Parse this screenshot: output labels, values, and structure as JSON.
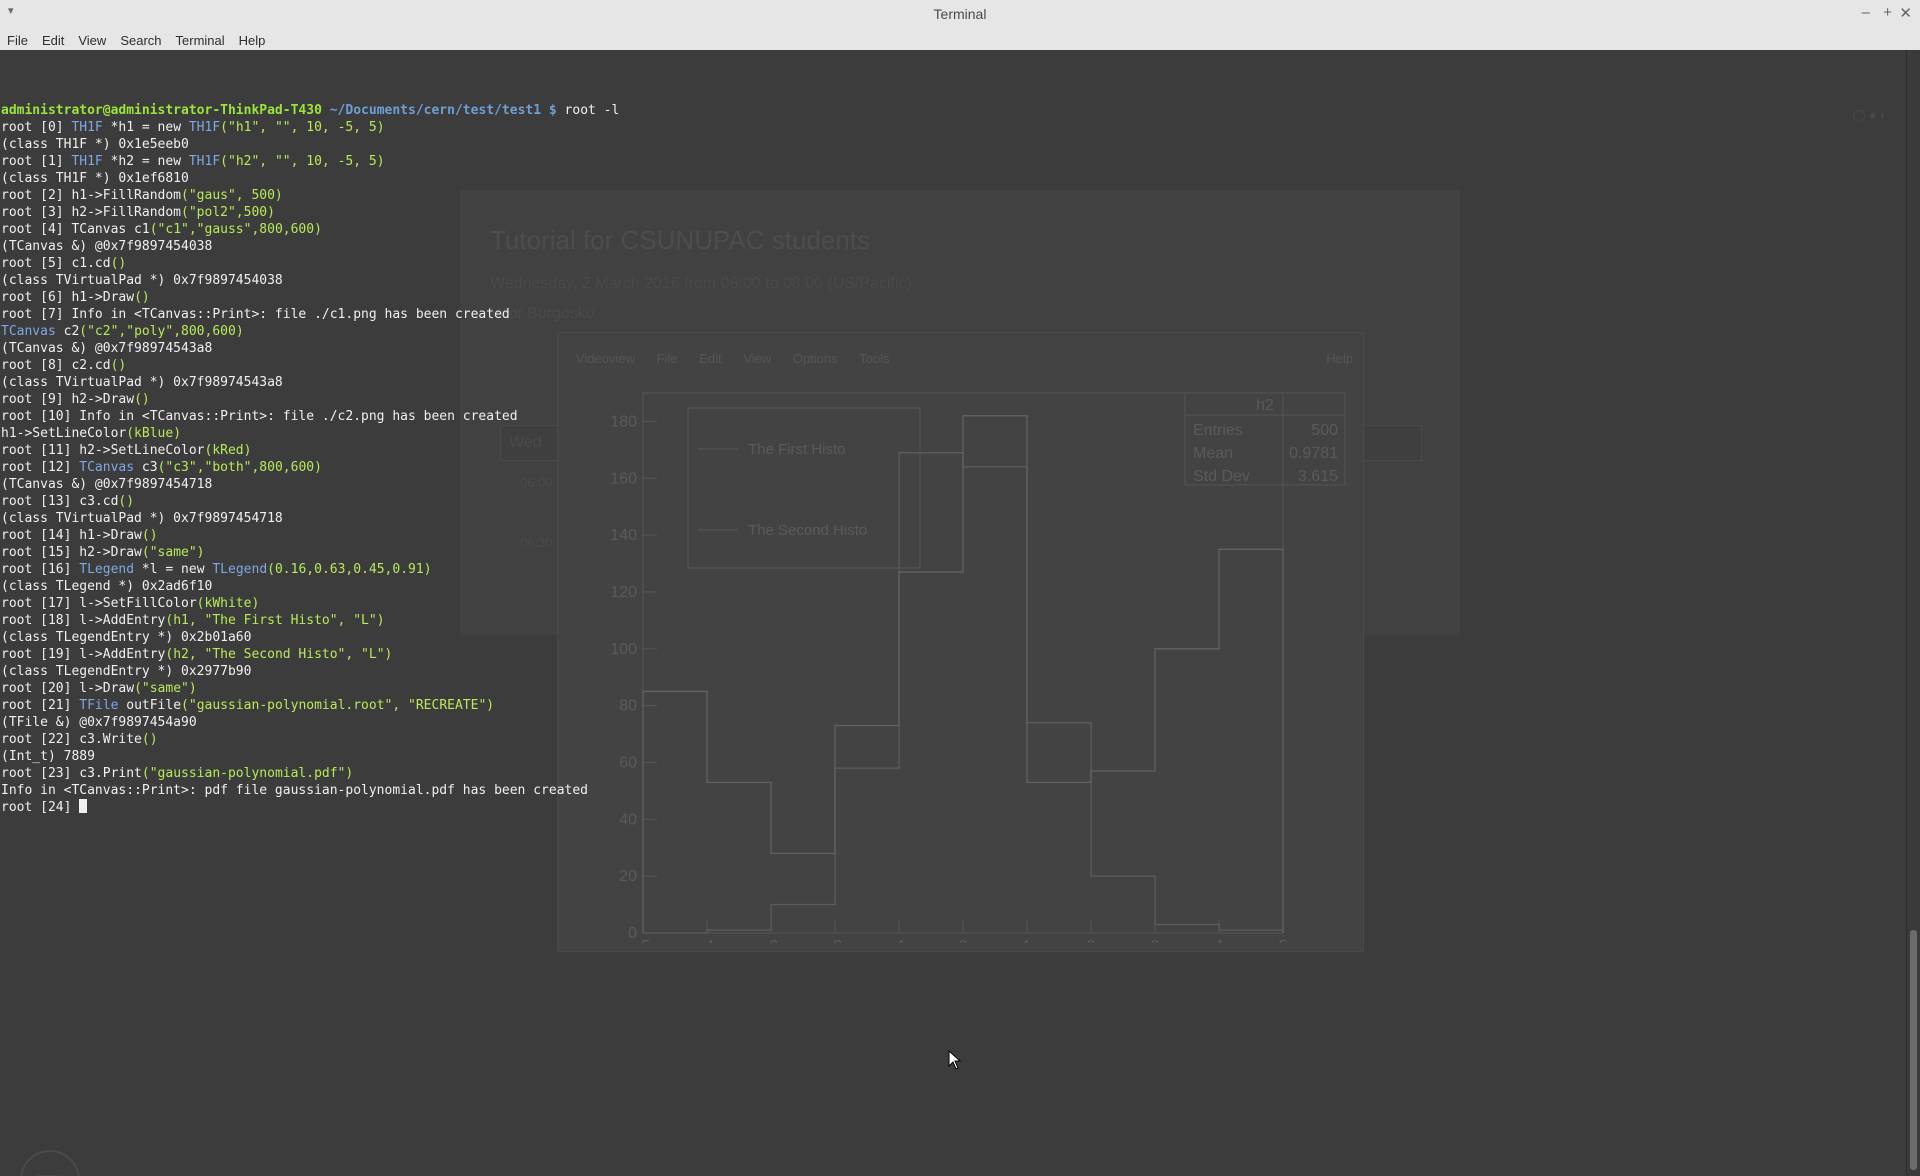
{
  "window": {
    "title": "Terminal",
    "menu": [
      "File",
      "Edit",
      "View",
      "Search",
      "Terminal",
      "Help"
    ]
  },
  "terminal": {
    "lines": [
      [
        {
          "t": "administrator@administrator-ThinkPad-T430",
          "c": "prompt"
        },
        {
          "t": " ~/Documents/cern/test/test1 $",
          "c": "path"
        },
        {
          "t": " root -l"
        }
      ],
      [
        {
          "t": "root [0] "
        },
        {
          "t": "TH1F",
          "c": "k"
        },
        {
          "t": " *h1 = new "
        },
        {
          "t": "TH1F",
          "c": "k"
        },
        {
          "t": "(\"h1\", \"\", 10, -5, 5)",
          "c": "gr"
        }
      ],
      [
        {
          "t": "(class TH1F *) 0x1e5eeb0"
        }
      ],
      [
        {
          "t": "root [1] "
        },
        {
          "t": "TH1F",
          "c": "k"
        },
        {
          "t": " *h2 = new "
        },
        {
          "t": "TH1F",
          "c": "k"
        },
        {
          "t": "(\"h2\", \"\", 10, -5, 5)",
          "c": "gr"
        }
      ],
      [
        {
          "t": "(class TH1F *) 0x1ef6810"
        }
      ],
      [
        {
          "t": "root [2] h1->FillRandom"
        },
        {
          "t": "(\"gaus\", 500)",
          "c": "gr"
        }
      ],
      [
        {
          "t": "root [3] h2->FillRandom"
        },
        {
          "t": "(\"pol2\",500)",
          "c": "gr"
        }
      ],
      [
        {
          "t": "root [4] TCanvas c1"
        },
        {
          "t": "(\"c1\",\"gauss\",800,600)",
          "c": "gr"
        }
      ],
      [
        {
          "t": "(TCanvas &) @0x7f9897454038"
        }
      ],
      [
        {
          "t": "root [5] c1.cd"
        },
        {
          "t": "()",
          "c": "gr"
        }
      ],
      [
        {
          "t": "(class TVirtualPad *) 0x7f9897454038"
        }
      ],
      [
        {
          "t": "root [6] h1->Draw"
        },
        {
          "t": "()",
          "c": "gr"
        }
      ],
      [
        {
          "t": "root [7] Info in <TCanvas::Print>: file ./c1.png has been created"
        }
      ],
      [
        {
          "t": "TCanvas",
          "c": "k"
        },
        {
          "t": " c2"
        },
        {
          "t": "(\"c2\",\"poly\",800,600)",
          "c": "gr"
        }
      ],
      [
        {
          "t": "(TCanvas &) @0x7f98974543a8"
        }
      ],
      [
        {
          "t": "root [8] c2.cd"
        },
        {
          "t": "()",
          "c": "gr"
        }
      ],
      [
        {
          "t": "(class TVirtualPad *) 0x7f98974543a8"
        }
      ],
      [
        {
          "t": "root [9] h2->Draw"
        },
        {
          "t": "()",
          "c": "gr"
        }
      ],
      [
        {
          "t": "root [10] Info in <TCanvas::Print>: file ./c2.png has been created"
        }
      ],
      [
        {
          "t": "h1->SetLineColor"
        },
        {
          "t": "(kBlue)",
          "c": "gr"
        }
      ],
      [
        {
          "t": "root [11] h2->SetLineColor"
        },
        {
          "t": "(kRed)",
          "c": "gr"
        }
      ],
      [
        {
          "t": "root [12] "
        },
        {
          "t": "TCanvas",
          "c": "k"
        },
        {
          "t": " c3"
        },
        {
          "t": "(\"c3\",\"both\",800,600)",
          "c": "gr"
        }
      ],
      [
        {
          "t": "(TCanvas &) @0x7f9897454718"
        }
      ],
      [
        {
          "t": "root [13] c3.cd"
        },
        {
          "t": "()",
          "c": "gr"
        }
      ],
      [
        {
          "t": "(class TVirtualPad *) 0x7f9897454718"
        }
      ],
      [
        {
          "t": "root [14] h1->Draw"
        },
        {
          "t": "()",
          "c": "gr"
        }
      ],
      [
        {
          "t": "root [15] h2->Draw"
        },
        {
          "t": "(\"same\")",
          "c": "gr"
        }
      ],
      [
        {
          "t": "root [16] "
        },
        {
          "t": "TLegend",
          "c": "k"
        },
        {
          "t": " *l = new "
        },
        {
          "t": "TLegend",
          "c": "k"
        },
        {
          "t": "(0.16,0.63,0.45,0.91)",
          "c": "gr"
        }
      ],
      [
        {
          "t": "(class TLegend *) 0x2ad6f10"
        }
      ],
      [
        {
          "t": "root [17] l->SetFillColor"
        },
        {
          "t": "(kWhite)",
          "c": "gr"
        }
      ],
      [
        {
          "t": "root [18] l->AddEntry"
        },
        {
          "t": "(h1, \"The First Histo\", \"L\")",
          "c": "gr"
        }
      ],
      [
        {
          "t": "(class TLegendEntry *) 0x2b01a60"
        }
      ],
      [
        {
          "t": "root [19] l->AddEntry"
        },
        {
          "t": "(h2, \"The Second Histo\", \"L\")",
          "c": "gr"
        }
      ],
      [
        {
          "t": "(class TLegendEntry *) 0x2977b90"
        }
      ],
      [
        {
          "t": "root [20] l->Draw"
        },
        {
          "t": "(\"same\")",
          "c": "gr"
        }
      ],
      [
        {
          "t": "root [21] "
        },
        {
          "t": "TFile",
          "c": "k"
        },
        {
          "t": " outFile"
        },
        {
          "t": "(\"gaussian-polynomial.root\", \"RECREATE\")",
          "c": "gr"
        }
      ],
      [
        {
          "t": "(TFile &) @0x7f9897454a90"
        }
      ],
      [
        {
          "t": "root [22] c3.Write"
        },
        {
          "t": "()",
          "c": "gr"
        }
      ],
      [
        {
          "t": "(Int_t) 7889"
        }
      ],
      [
        {
          "t": "root [23] c3.Print"
        },
        {
          "t": "(\"gaussian-polynomial.pdf\")",
          "c": "gr"
        }
      ],
      [
        {
          "t": "Info in <TCanvas::Print>: pdf file gaussian-polynomial.pdf has been created"
        }
      ],
      [
        {
          "t": "root [24] "
        }
      ]
    ],
    "colors": {
      "background": "#3c3c3c",
      "text": "#f0f0f0",
      "prompt": "#9be53a",
      "path": "#6d9fd6",
      "keyword": "#7ea8e2",
      "argument": "#b7ea58"
    }
  },
  "background_page": {
    "title": "Tutorial for CSUNUPAC students",
    "subtitle": "Wednesday, 2 March 2016 from 06:00 to 08:00 (US/Pacific)",
    "text": "Vitor Burgosko",
    "box_label": "Wed",
    "times": [
      "06:00",
      "06:30"
    ]
  },
  "root_canvas": {
    "menu": [
      "File",
      "Edit",
      "View",
      "Options",
      "Tools"
    ],
    "menu_left": "Videoview",
    "menu_help": "Help",
    "stats": {
      "title": "h2",
      "rows": [
        [
          "Entries",
          "500"
        ],
        [
          "Mean",
          "0.9781"
        ],
        [
          "Std Dev",
          "3.615"
        ]
      ]
    },
    "legend": [
      "The First Histo",
      "The Second Histo"
    ]
  },
  "chart_data": {
    "type": "bar",
    "title": "",
    "xlim": [
      -5,
      5
    ],
    "ylim": [
      0,
      190
    ],
    "xticks": [
      -5,
      -4,
      -3,
      -2,
      -1,
      0,
      1,
      2,
      3,
      4,
      5
    ],
    "yticks": [
      0,
      20,
      40,
      60,
      80,
      100,
      120,
      140,
      160,
      180
    ],
    "bins": [
      -5,
      -4,
      -3,
      -2,
      -1,
      0,
      1,
      2,
      3,
      4,
      5
    ],
    "series": [
      {
        "name": "The First Histo",
        "values": [
          0,
          1,
          10,
          58,
          169,
          164,
          74,
          20,
          3,
          1
        ]
      },
      {
        "name": "The Second Histo",
        "values": [
          85,
          53,
          28,
          73,
          127,
          182,
          53,
          57,
          100,
          135
        ]
      }
    ]
  }
}
